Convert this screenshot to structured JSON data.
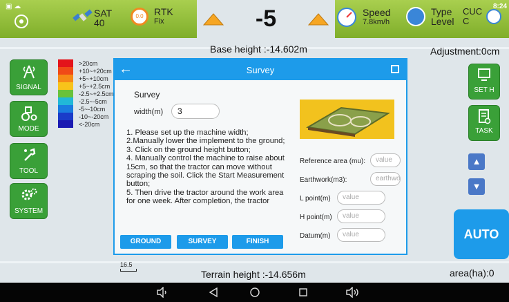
{
  "status_bar": {
    "sat_label": "SAT",
    "sat_value": "40",
    "rtk_label": "RTK",
    "rtk_value": "Fix",
    "rtk_badge": "0.0",
    "deviation": "-5",
    "speed_label": "Speed",
    "speed_value": "7.8km/h",
    "type_label": "Type",
    "type_value": "Level",
    "cut_label": "CUC",
    "cut_value": "C",
    "clock": "8:24"
  },
  "map": {
    "base_height": "Base height :-14.602m",
    "terrain_height": "Terrain height :-14.656m",
    "adjustment": "Adjustment:0cm",
    "area": "area(ha):0",
    "scale": "16.5"
  },
  "legend": [
    {
      "label": ">20cm",
      "color": "#e4141b"
    },
    {
      "label": "+10~+20cm",
      "color": "#f04a17"
    },
    {
      "label": "+5~+10cm",
      "color": "#f68a16"
    },
    {
      "label": "+5~+2.5cm",
      "color": "#f8c31a"
    },
    {
      "label": "-2.5~+2.5cm",
      "color": "#69c23a"
    },
    {
      "label": "-2.5~-5cm",
      "color": "#21b8d8"
    },
    {
      "label": "-5~-10cm",
      "color": "#1a7ce0"
    },
    {
      "label": "-10~-20cm",
      "color": "#1a3cc9"
    },
    {
      "label": "<-20cm",
      "color": "#1a1ab2"
    }
  ],
  "left_menu": [
    {
      "label": "SIGNAL",
      "icon": "signal-tower-icon",
      "glyph": "⩚"
    },
    {
      "label": "MODE",
      "icon": "tractor-icon",
      "glyph": "⚙"
    },
    {
      "label": "TOOL",
      "icon": "tool-icon",
      "glyph": "✐"
    },
    {
      "label": "SYSTEM",
      "icon": "gears-icon",
      "glyph": "⚙"
    }
  ],
  "right_menu": {
    "set_h": "SET H",
    "task": "TASK",
    "auto": "AUTO"
  },
  "dialog": {
    "title": "Survey",
    "section": "Survey",
    "width_label": "width(m)",
    "width_value": "3",
    "instructions": [
      "1. Please set up the machine width;",
      "2.Manually lower the implement to the ground;",
      "3. Click on the ground height button;",
      "4. Manually control the machine to raise about 15cm, so that the tractor can move without scraping the soil. Click the Start Measurement button;",
      "5. Then drive the tractor around the work area for one week. After completion, the tractor"
    ],
    "buttons": {
      "ground": "GROUND",
      "survey": "SURVEY",
      "finish": "FINISH"
    },
    "fields": {
      "reference_area_label": "Reference area (mu):",
      "reference_area_placeholder": "value",
      "earthwork_label": "Earthwork(m3):",
      "earthwork_placeholder": "earthwork",
      "l_point_label": "L point(m)",
      "l_point_placeholder": "value",
      "h_point_label": "H point(m)",
      "h_point_placeholder": "value",
      "datum_label": "Datum(m)",
      "datum_placeholder": "value"
    }
  },
  "colors": {
    "accent": "#1d9bea",
    "menu_green": "#3aa038",
    "top_bar": "#8fbe35"
  }
}
